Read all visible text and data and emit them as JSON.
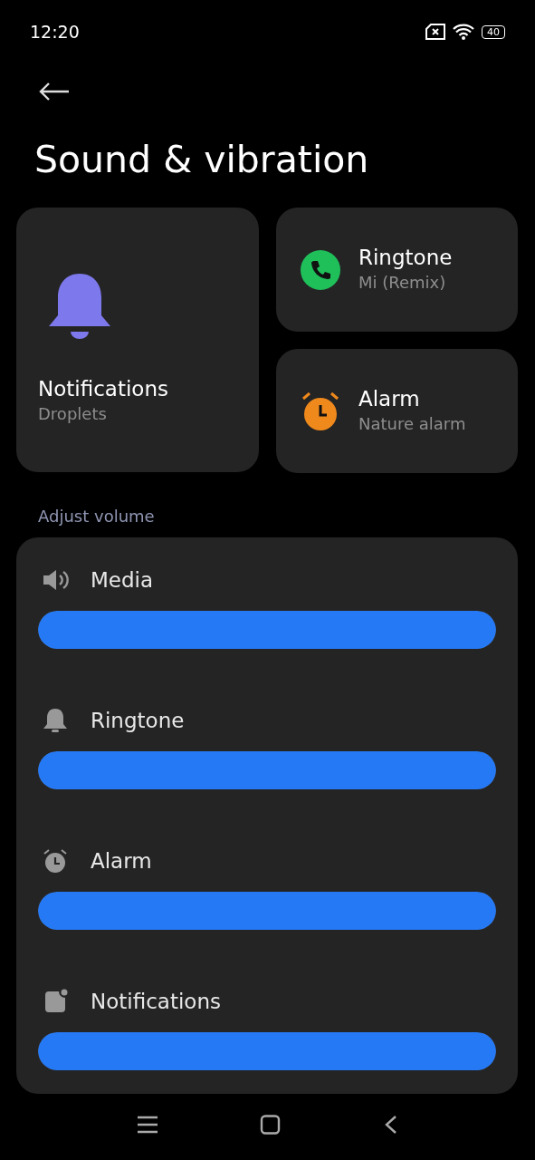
{
  "status_bar": {
    "time": "12:20",
    "battery": "40"
  },
  "title": "Sound & vibration",
  "tiles": [
    {
      "kind": "bell",
      "title": "Notifications",
      "subtitle": "Droplets"
    },
    {
      "kind": "phone",
      "title": "Ringtone",
      "subtitle": "Mi (Remix)"
    },
    {
      "kind": "alarm",
      "title": "Alarm",
      "subtitle": "Nature alarm"
    }
  ],
  "section_label": "Adjust volume",
  "volumes": [
    {
      "kind": "media",
      "label": "Media",
      "level": 1
    },
    {
      "kind": "ringtone",
      "label": "Ringtone",
      "level": 1
    },
    {
      "kind": "alarm",
      "label": "Alarm",
      "level": 1
    },
    {
      "kind": "notifications",
      "label": "Notifications",
      "level": 1
    }
  ]
}
